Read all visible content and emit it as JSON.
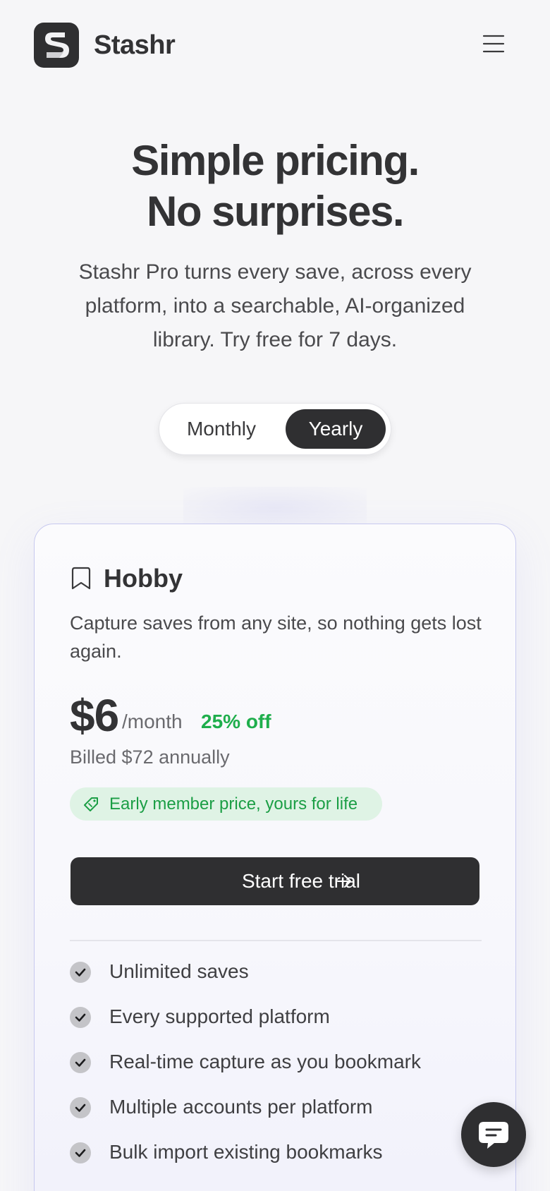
{
  "header": {
    "brand": "Stashr",
    "logo_icon": "stashr-logo-icon",
    "menu_icon": "hamburger-menu-icon"
  },
  "hero": {
    "title_line1": "Simple pricing.",
    "title_line2": "No surprises.",
    "subtitle": "Stashr Pro turns every save, across every platform, into a searchable, AI-organized library. Try free for 7 days."
  },
  "billing_toggle": {
    "options": [
      "Monthly",
      "Yearly"
    ],
    "selected": "Yearly"
  },
  "plan": {
    "icon": "bookmark-icon",
    "name": "Hobby",
    "description": "Capture saves from any site, so nothing gets lost again.",
    "price": "$6",
    "period": "/month",
    "discount": "25% off",
    "billed": "Billed $72 annually",
    "badge": {
      "icon": "tag-icon",
      "text": "Early member price, yours for life"
    },
    "cta": {
      "label": "Start free trial",
      "icon": "arrow-right-icon"
    },
    "features": [
      "Unlimited saves",
      "Every supported platform",
      "Real-time capture as you bookmark",
      "Multiple accounts per platform",
      "Bulk import existing bookmarks"
    ]
  },
  "chat": {
    "icon": "chat-bubble-icon"
  },
  "colors": {
    "background": "#f6f6f8",
    "primary_dark": "#2f2f31",
    "accent_green": "#1fae4c",
    "badge_bg": "#dff3e5",
    "card_border": "#c7c9ef"
  }
}
